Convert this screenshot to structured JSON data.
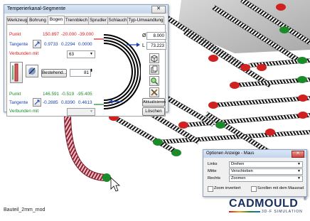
{
  "viewport": {
    "filename": "Bauteil_2mm_mod",
    "logo_text": "CADMOULD",
    "logo_sub": "3D-F SIMULATION",
    "logo_reg": "®"
  },
  "main_dialog": {
    "title": "Temperierkanal-Segmente",
    "close_label": "✕",
    "tabs": [
      "Werkzeug",
      "Bohrung",
      "Bogen",
      "Trennblech",
      "Sprudler",
      "Schlauch",
      "Typ-Umwandlung"
    ],
    "active_tab": "Bogen",
    "punkt1": {
      "label": "Punkt",
      "x": "150.897",
      "y": "-20.000",
      "z": "-39.000"
    },
    "tangente1": {
      "label": "Tangente",
      "x": "0.9733",
      "y": "0.2294",
      "z": "0.0000"
    },
    "verbunden1": {
      "label": "Verbunden mit",
      "value": "63"
    },
    "diameter_symbol": "Ø",
    "diameter_value": "8.000",
    "length_symbol": "L",
    "length_value": "73.223",
    "bestehend_button": "Bestehend...",
    "bestehend_value": "81",
    "punkt2": {
      "label": "Punkt",
      "x": "146.591",
      "y": "-0.519",
      "z": "-95.405"
    },
    "tangente2": {
      "label": "Tangente",
      "x": "-0.2885",
      "y": "0.8390",
      "z": "0.4613"
    },
    "verbunden2": {
      "label": "Verbunden mit",
      "value": ""
    },
    "aktualisieren_button": "Aktualisieren",
    "loeschen_button": "Löschen"
  },
  "mouse_dialog": {
    "title": "Optionen Anzeige - Maus",
    "close_label": "✕",
    "rows": [
      {
        "label": "Links",
        "value": "Drehen"
      },
      {
        "label": "Mitte",
        "value": "Verschieben"
      },
      {
        "label": "Rechts",
        "value": "Zoomen"
      }
    ],
    "zoom_invertiert": "Zoom invertiert",
    "scrollen_mausrad": "Scrollen mit dem Mausrad"
  },
  "colors": {
    "red": "#e01818",
    "blue": "#1a3fb0",
    "green": "#1a8a2a",
    "logo_blue": "#1a3060"
  }
}
